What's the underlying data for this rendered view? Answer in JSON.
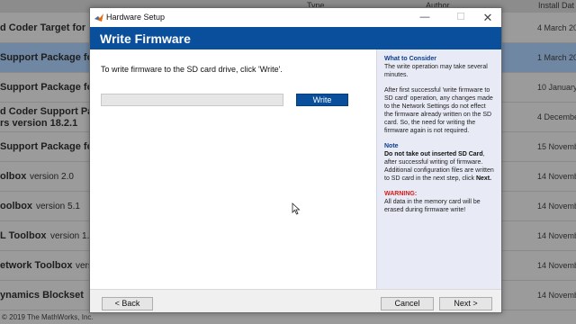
{
  "background": {
    "columns": {
      "type": "Type",
      "author": "Author",
      "install_date": "Install Dat"
    },
    "rows": [
      {
        "title": "d Coder Target for Ea",
        "version": "",
        "date": "4 March 20",
        "selected": false
      },
      {
        "title": "Support Package for",
        "version": "",
        "date": "1 March 20",
        "selected": true
      },
      {
        "title": "Support Package for",
        "version": "",
        "date": "10 January",
        "selected": false
      },
      {
        "title": "d Coder Support Pac",
        "version": "",
        "date": "4 December",
        "selected": false
      },
      {
        "title": "Support Package for",
        "version": "",
        "date": "15 Novembe",
        "selected": false
      },
      {
        "title": "olbox",
        "version": "version 2.0",
        "date": "14 Novembe",
        "selected": false
      },
      {
        "title": "oolbox",
        "version": "version 5.1",
        "date": "14 Novembe",
        "selected": false
      },
      {
        "title": "L Toolbox",
        "version": "version 1.7",
        "date": "14 Novembe",
        "selected": false
      },
      {
        "title": "etwork Toolbox",
        "version": "versio",
        "date": "14 Novembe",
        "selected": false
      },
      {
        "title": "ynamics Blockset",
        "version": "",
        "date": "14 Novembe",
        "selected": false
      }
    ],
    "row4_sub": "rs version 18.2.1",
    "copyright": "© 2019 The MathWorks, Inc."
  },
  "dialog": {
    "window_title": "Hardware Setup",
    "controls": {
      "minimize": "—",
      "maximize": "☐",
      "close": "✕"
    },
    "banner_title": "Write Firmware",
    "instruction": "To write firmware to the SD card drive, click 'Write'.",
    "progress_fraction": 0,
    "write_label": "Write",
    "side": {
      "consider_heading": "What to Consider",
      "consider_p1": "The write operation may take several minutes.",
      "consider_p2": "After first successful 'write firmware to SD card' operation, any changes made to the Network Settings do not effect the firmware already written on the SD card. So, the need for writing the firmware again is not required.",
      "note_heading": "Note",
      "note_bold": "Do not take out inserted SD Card",
      "note_text": ", after successful writing of firmware. Additional configuration files are written to SD card in the next step, click ",
      "note_next": "Next.",
      "warning_heading": "WARNING:",
      "warning_text": "All data in the memory card will be erased during firmware write!"
    },
    "footer": {
      "back": "< Back",
      "cancel": "Cancel",
      "next": "Next >"
    }
  },
  "colors": {
    "banner": "#0a4f9c",
    "side_panel": "#e8ebf5",
    "warning": "#d41b1b",
    "heading": "#0b3e8f"
  }
}
